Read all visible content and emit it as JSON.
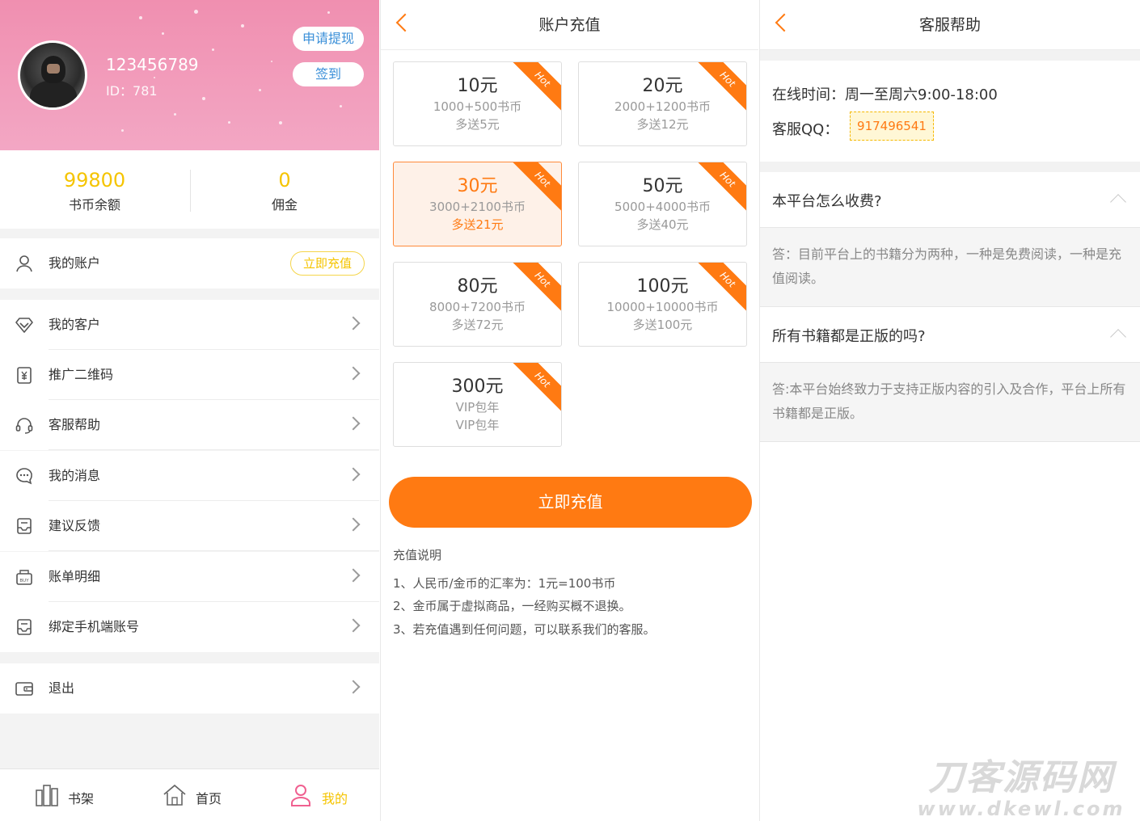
{
  "profile": {
    "username": "123456789",
    "id_label": "ID：781",
    "withdraw_btn": "申请提现",
    "signin_btn": "签到"
  },
  "stats": {
    "balance_value": "99800",
    "balance_label": "书币余额",
    "commission_value": "0",
    "commission_label": "佣金"
  },
  "account": {
    "label": "我的账户",
    "recharge_tag": "立即充值"
  },
  "menu": [
    {
      "label": "我的客户",
      "icon": "diamond-icon"
    },
    {
      "label": "推广二维码",
      "icon": "yuan-tag-icon"
    },
    {
      "label": "客服帮助",
      "icon": "headset-icon"
    },
    {
      "label": "我的消息",
      "icon": "chat-bubble-icon"
    },
    {
      "label": "建议反馈",
      "icon": "inbox-icon"
    },
    {
      "label": "账单明细",
      "icon": "buy-box-icon"
    },
    {
      "label": "绑定手机端账号",
      "icon": "inbox-icon"
    }
  ],
  "logout": {
    "label": "退出",
    "icon": "wallet-icon"
  },
  "tabs": [
    {
      "label": "书架",
      "icon": "bookshelf-icon"
    },
    {
      "label": "首页",
      "icon": "home-icon"
    },
    {
      "label": "我的",
      "icon": "user-icon"
    }
  ],
  "recharge": {
    "title": "账户充值",
    "hot_label": "Hot",
    "options": [
      {
        "amount": "10元",
        "coins": "1000+500书币",
        "bonus": "多送5元"
      },
      {
        "amount": "20元",
        "coins": "2000+1200书币",
        "bonus": "多送12元"
      },
      {
        "amount": "30元",
        "coins": "3000+2100书币",
        "bonus": "多送21元"
      },
      {
        "amount": "50元",
        "coins": "5000+4000书币",
        "bonus": "多送40元"
      },
      {
        "amount": "80元",
        "coins": "8000+7200书币",
        "bonus": "多送72元"
      },
      {
        "amount": "100元",
        "coins": "10000+10000书币",
        "bonus": "多送100元"
      },
      {
        "amount": "300元",
        "coins": "VIP包年",
        "bonus": "VIP包年"
      }
    ],
    "selected_index": 2,
    "submit_btn": "立即充值",
    "notes_title": "充值说明",
    "notes": [
      "1、人民币/金币的汇率为：1元=100书币",
      "2、金币属于虚拟商品，一经购买概不退换。",
      "3、若充值遇到任何问题，可以联系我们的客服。"
    ]
  },
  "help": {
    "title": "客服帮助",
    "online_time": "在线时间：周一至周六9:00-18:00",
    "qq_label": "客服QQ：",
    "qq_value": "917496541",
    "faq": [
      {
        "q": "本平台怎么收费?",
        "a": "答：目前平台上的书籍分为两种，一种是免费阅读，一种是充值阅读。"
      },
      {
        "q": "所有书籍都是正版的吗?",
        "a": "答:本平台始终致力于支持正版内容的引入及合作，平台上所有书籍都是正版。"
      }
    ]
  },
  "watermark": {
    "line1": "刀客源码网",
    "line2": "www.dkewl.com"
  },
  "colors": {
    "accent_orange": "#ff7a12",
    "accent_yellow": "#f5c400",
    "link_blue": "#3a8fd8",
    "profile_pink": "#f3a7c4"
  }
}
